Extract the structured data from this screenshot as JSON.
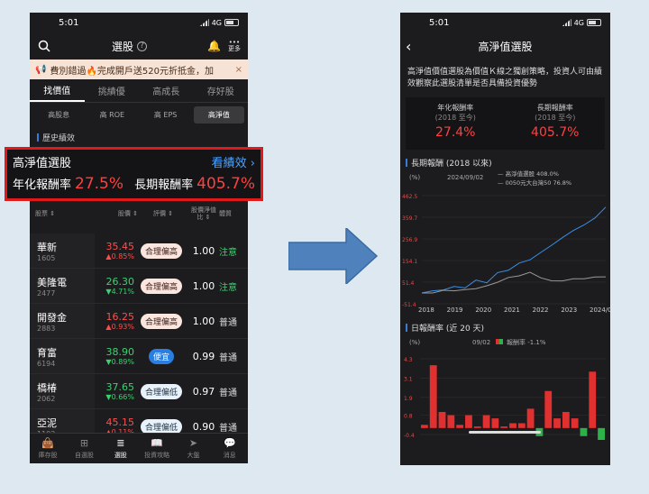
{
  "left": {
    "status": {
      "time": "5:01",
      "network": "4G"
    },
    "topbar": {
      "title": "選股",
      "more_label": "更多"
    },
    "promo": {
      "text": "費別錯過🔥完成開戶送520元折抵金，加",
      "close": "×"
    },
    "tabs": [
      "找價值",
      "挑績優",
      "高成長",
      "存好股"
    ],
    "subtabs": [
      "高股息",
      "高 ROE",
      "高 EPS",
      "高淨值"
    ],
    "section": "歷史績效",
    "highlight": {
      "name": "高淨值選股",
      "link": "看績效 ›",
      "annual_label": "年化報酬率",
      "annual_value": "27.5%",
      "long_label": "長期報酬率",
      "long_value": "405.7%"
    },
    "table_head": {
      "stock": "股票 ⇕",
      "price": "股價 ⇕",
      "rating": "評價 ⇕",
      "pb": "股價淨值比 ⇕",
      "tag": "體質"
    },
    "rows": [
      {
        "name": "華新",
        "code": "1605",
        "price": "35.45",
        "change": "▲0.85%",
        "dir": "up",
        "rating": "合理偏高",
        "pb": "1.00",
        "tag": "注意"
      },
      {
        "name": "美隆電",
        "code": "2477",
        "price": "26.30",
        "change": "▼4.71%",
        "dir": "down",
        "rating": "合理偏高",
        "pb": "1.00",
        "tag": "注意"
      },
      {
        "name": "開發金",
        "code": "2883",
        "price": "16.25",
        "change": "▲0.93%",
        "dir": "up",
        "rating": "合理偏高",
        "pb": "1.00",
        "tag": "普通"
      },
      {
        "name": "育富",
        "code": "6194",
        "price": "38.90",
        "change": "▼0.89%",
        "dir": "down",
        "rating": "便宜",
        "pb": "0.99",
        "tag": "普通"
      },
      {
        "name": "橋椿",
        "code": "2062",
        "price": "37.65",
        "change": "▼0.66%",
        "dir": "down",
        "rating": "合理偏低",
        "pb": "0.97",
        "tag": "普通"
      },
      {
        "name": "亞泥",
        "code": "1102",
        "price": "45.15",
        "change": "▲0.11%",
        "dir": "up",
        "rating": "合理偏低",
        "pb": "0.90",
        "tag": "普通"
      }
    ],
    "nav": [
      "庫存股",
      "自選股",
      "選股",
      "投資攻略",
      "大盤",
      "消息"
    ]
  },
  "right": {
    "status": {
      "time": "5:01",
      "network": "4G"
    },
    "title": "高淨值選股",
    "desc": "高淨值價值選股為價值Ｋ線之獨創策略，投資人可由績效觀察此選股清單是否具備投資優勢",
    "annual_label": "年化報酬率",
    "annual_sub": "(2018 至今)",
    "annual_value": "27.4%",
    "long_label": "長期報酬率",
    "long_sub": "(2018 至今)",
    "long_value": "405.7%",
    "long_section": "長期報酬 (2018 以來)",
    "daily_section": "日報酬率 (近 20 天)"
  },
  "chart_data": [
    {
      "type": "line",
      "unit_label": "(%)",
      "date_label": "2024/09/02",
      "series": [
        {
          "name": "高淨值選股 408.0%",
          "color": "#3a8fe8",
          "values": [
            0,
            10,
            15,
            30,
            25,
            60,
            50,
            95,
            110,
            140,
            160,
            190,
            230,
            260,
            300,
            320,
            360,
            408
          ]
        },
        {
          "name": "0050元大台灣50 76.8%",
          "color": "#9a9a9a",
          "values": [
            0,
            5,
            8,
            15,
            12,
            25,
            30,
            55,
            70,
            85,
            95,
            75,
            55,
            60,
            65,
            70,
            74,
            76.8
          ]
        }
      ],
      "x_ticks": [
        "2018",
        "2019",
        "2020",
        "2021",
        "2022",
        "2023",
        "2024/09/02"
      ],
      "y_ticks": [
        "462.5",
        "359.7",
        "256.9",
        "154.1",
        "51.4",
        "-51.4"
      ],
      "ylim": [
        -51.4,
        462.5
      ]
    },
    {
      "type": "bar",
      "unit_label": "(%)",
      "date_label": "09/02",
      "series_name": "報酬率 -1.1%",
      "y_ticks": [
        "4.3",
        "3.1",
        "1.9",
        "0.8",
        "-0.4"
      ],
      "ylim": [
        -0.4,
        4.3
      ],
      "values": [
        0.2,
        3.9,
        1.0,
        0.8,
        0.2,
        0.8,
        0.1,
        0.8,
        0.6,
        0.1,
        0.3,
        0.3,
        1.2,
        -0.5,
        2.3,
        0.6,
        1.0,
        0.6,
        -0.5,
        3.5,
        -1.1
      ]
    }
  ]
}
